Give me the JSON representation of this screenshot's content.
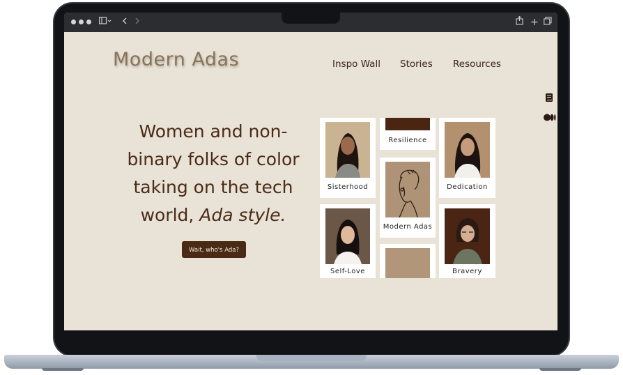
{
  "site": {
    "logo": "Modern Adas",
    "nav": [
      "Inspo Wall",
      "Stories",
      "Resources"
    ]
  },
  "hero": {
    "headline_plain": "Women and non-binary folks of color taking on the tech world, ",
    "headline_emphasis": "Ada style.",
    "cta_label": "Wait, who's Ada?"
  },
  "gallery": [
    {
      "caption": "Sisterhood"
    },
    {
      "caption": "Resilience"
    },
    {
      "caption": "Dedication"
    },
    {
      "caption": "Modern Adas"
    },
    {
      "caption": "Self-Love"
    },
    {
      "caption": "Bravery"
    }
  ],
  "colors": {
    "page_bg": "#e8e3d6",
    "brand_brown": "#4a2a14",
    "logo_tan": "#8a7358",
    "card_tan": "#b29679"
  },
  "icons": {
    "side": [
      "book-icon",
      "medium-icon"
    ],
    "toolbar": [
      "sidebar-icon",
      "back-icon",
      "forward-icon",
      "share-icon",
      "new-tab-icon",
      "tabs-overview-icon"
    ]
  }
}
